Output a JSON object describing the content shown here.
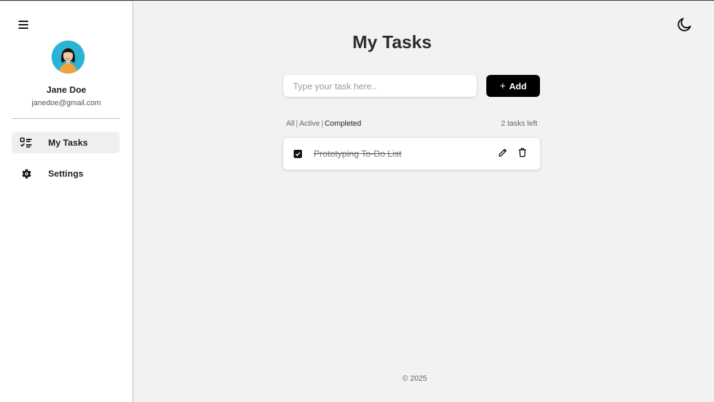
{
  "sidebar": {
    "menu_icon": "hamburger-icon",
    "user": {
      "name": "Jane Doe",
      "email": "janedoe@gmail.com"
    },
    "nav": [
      {
        "label": "My Tasks",
        "icon": "task-list-icon",
        "active": true
      },
      {
        "label": "Settings",
        "icon": "gear-icon",
        "active": false
      }
    ]
  },
  "header": {
    "theme_icon": "moon-icon"
  },
  "main": {
    "title": "My Tasks",
    "input_placeholder": "Type your task here..",
    "add_label": "Add",
    "filters": [
      "All",
      "Active",
      "Completed"
    ],
    "selected_filter": "Completed",
    "tasks_left": "2 tasks left",
    "tasks": [
      {
        "text": "Prototyping To-Do List",
        "completed": true
      }
    ]
  },
  "footer": {
    "text": "© 2025"
  },
  "colors": {
    "background": "#f2f2f5",
    "sidebar": "#ffffff",
    "accent": "#000000",
    "avatar_bg": "#2bb3d6"
  }
}
